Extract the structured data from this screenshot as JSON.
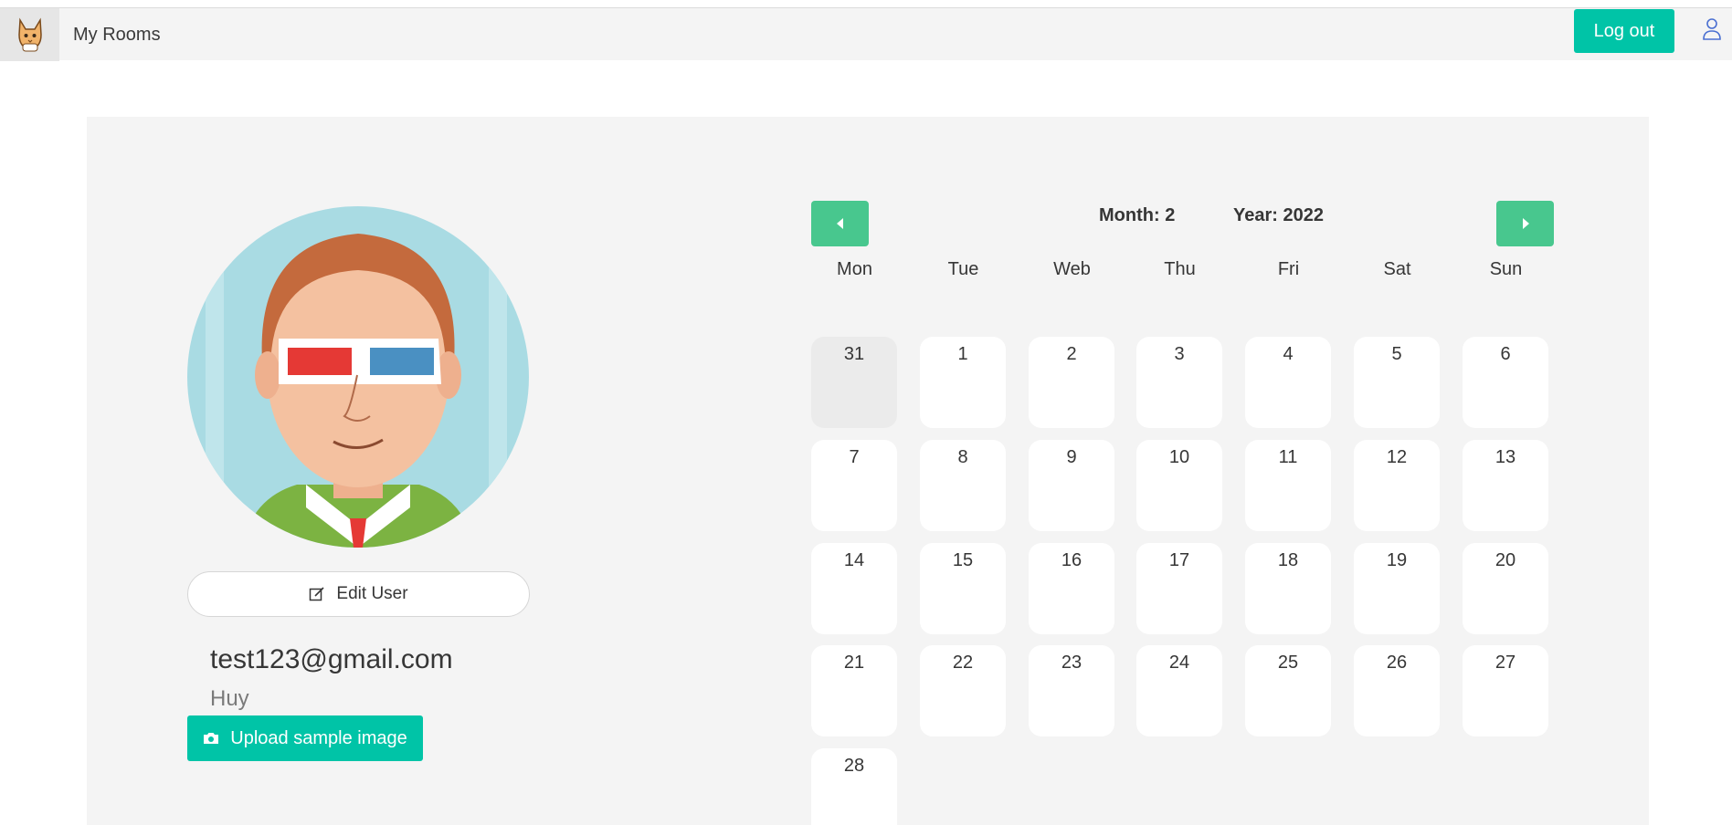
{
  "topbar": {
    "brand": "My Rooms",
    "logout_label": "Log out",
    "logo_icon": "cat-logo-icon",
    "user_icon": "user-icon"
  },
  "profile": {
    "edit_label": "Edit User",
    "email": "test123@gmail.com",
    "name": "Huy",
    "upload_label": "Upload sample image"
  },
  "calendar": {
    "month_text": "Month: 2",
    "year_text": "Year: 2022",
    "weekdays": [
      "Mon",
      "Tue",
      "Web",
      "Thu",
      "Fri",
      "Sat",
      "Sun"
    ],
    "days": [
      "31",
      "1",
      "2",
      "3",
      "4",
      "5",
      "6",
      "7",
      "8",
      "9",
      "10",
      "11",
      "12",
      "13",
      "14",
      "15",
      "16",
      "17",
      "18",
      "19",
      "20",
      "21",
      "22",
      "23",
      "24",
      "25",
      "26",
      "27",
      "28"
    ]
  },
  "colors": {
    "accent": "#00c4a7",
    "nav_button": "#48c78e",
    "panel": "#f4f4f4"
  }
}
